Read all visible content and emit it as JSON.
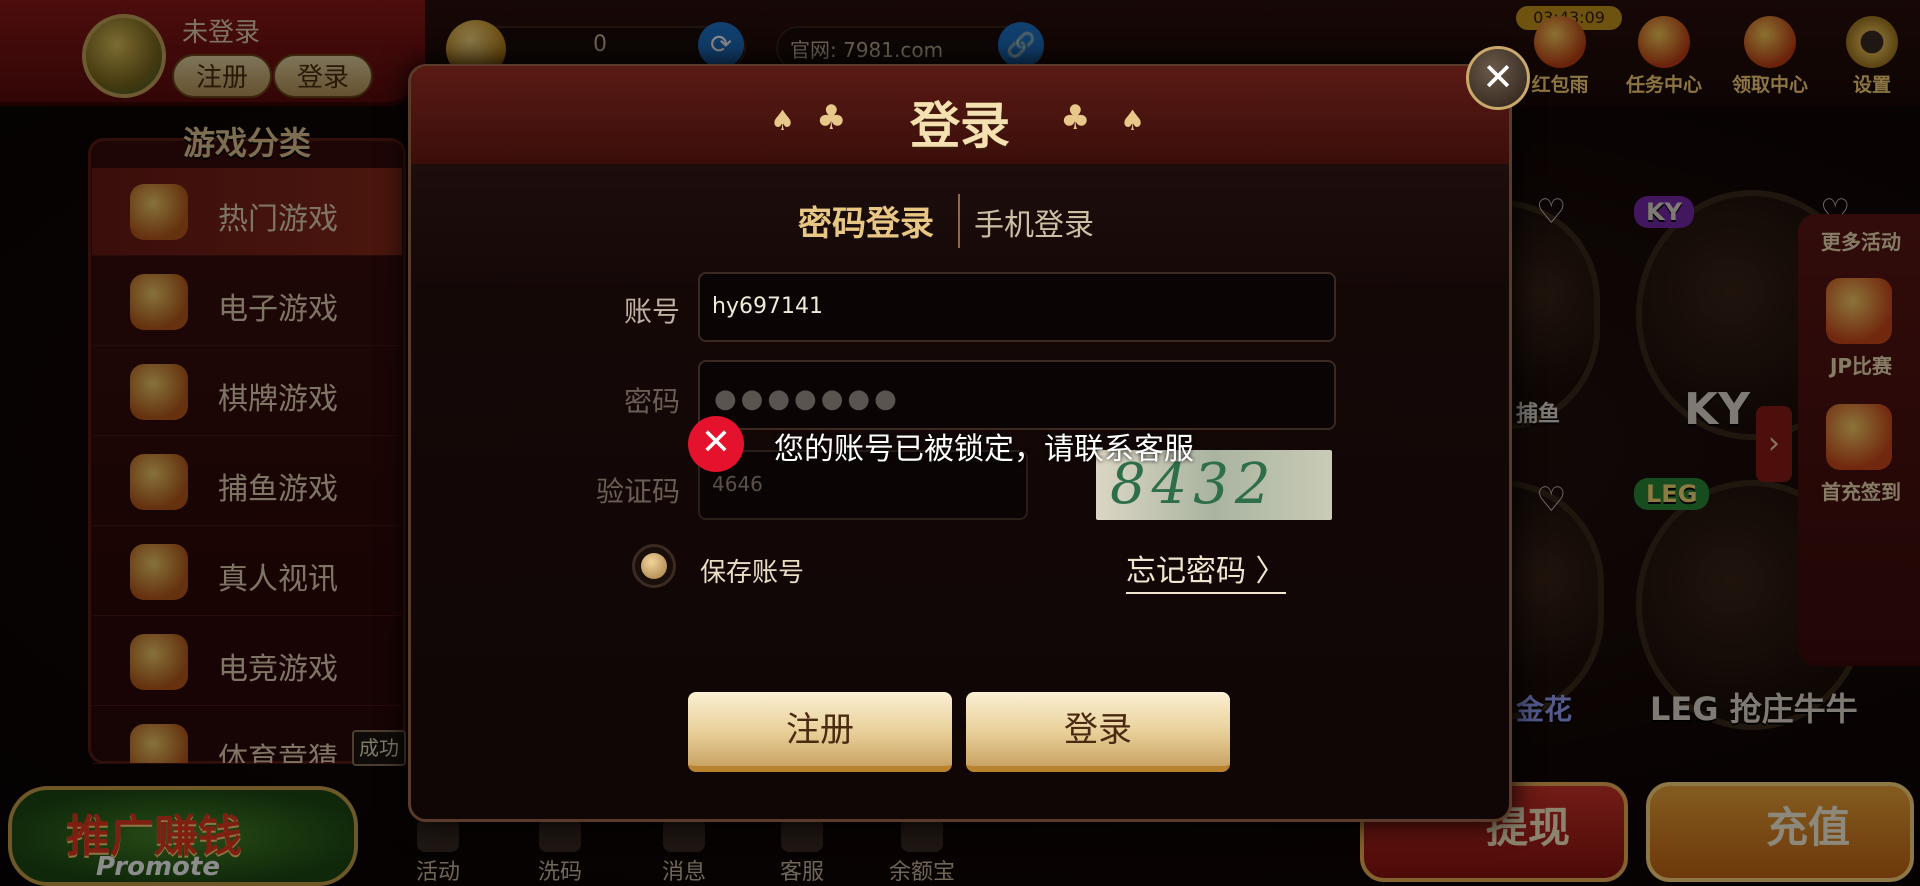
{
  "topbar": {
    "login_status": "未登录",
    "register_label": "注册",
    "login_label": "登录",
    "coin_balance": "0",
    "website": "官网: 7981.com",
    "timer": "03:43:09",
    "icons": [
      {
        "label": "红包雨",
        "icon": "red-envelope-icon"
      },
      {
        "label": "任务中心",
        "icon": "task-center-icon"
      },
      {
        "label": "领取中心",
        "icon": "claim-center-icon"
      },
      {
        "label": "设置",
        "icon": "gear-icon"
      }
    ]
  },
  "sidebar": {
    "title": "游戏分类",
    "items": [
      {
        "label": "热门游戏",
        "active": true
      },
      {
        "label": "电子游戏",
        "active": false
      },
      {
        "label": "棋牌游戏",
        "active": false
      },
      {
        "label": "捕鱼游戏",
        "active": false
      },
      {
        "label": "真人视讯",
        "active": false
      },
      {
        "label": "电竞游戏",
        "active": false
      },
      {
        "label": "体育竞猜",
        "active": false
      }
    ],
    "success_tip": "成功"
  },
  "promote": {
    "cn": "推广赚钱",
    "en": "Promote"
  },
  "bottom_nav": [
    "活动",
    "洗码",
    "消息",
    "客服",
    "余额宝"
  ],
  "actions": {
    "withdraw": "提现",
    "recharge": "充值"
  },
  "games": {
    "game_a_label": "捕鱼",
    "game_b_badge": "KY",
    "game_b_label": "KY",
    "game_c_label": "金花",
    "game_d_badge": "LEG",
    "game_d_label": "LEG 抢庄牛牛"
  },
  "side_panel": {
    "more": "更多活动",
    "jp": "JP比赛",
    "first_charge": "首充签到"
  },
  "modal": {
    "title": "登录",
    "tabs": {
      "active": "密码登录",
      "inactive": "手机登录"
    },
    "account_label": "账号",
    "account_value": "hy697141",
    "password_label": "密码",
    "password_mask": "●●●●●●●",
    "captcha_label": "验证码",
    "captcha_value": "4646",
    "captcha_image_text": "8432",
    "save_account_label": "保存账号",
    "forgot_password": "忘记密码 〉",
    "register_button": "注册",
    "login_button": "登录"
  },
  "toast": {
    "message": "您的账号已被锁定，请联系客服"
  },
  "colors": {
    "accent": "#e8c684",
    "error": "#e4122c",
    "link_button": "#1f73c9"
  }
}
